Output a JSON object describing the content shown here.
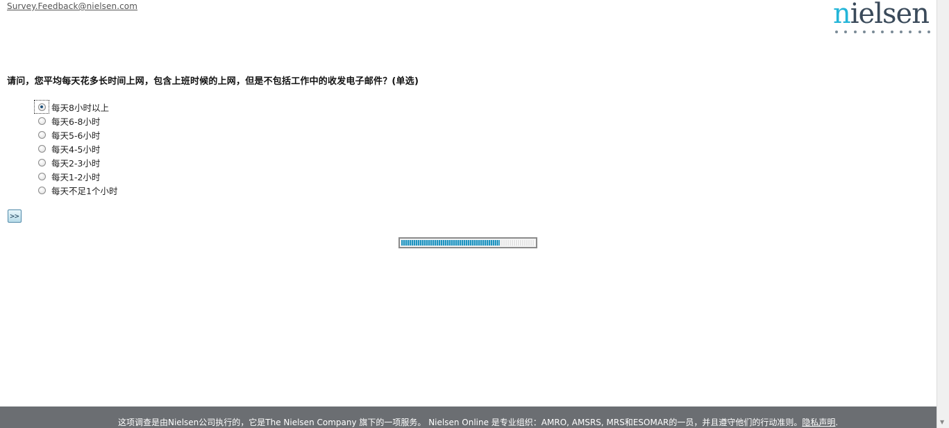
{
  "header": {
    "feedback_email": "Survey.Feedback@nielsen.com",
    "logo_text_first": "n",
    "logo_text_rest": "ielsen"
  },
  "question": {
    "text": "请问，您平均每天花多长时间上网，包含上班时候的上网，但是不包括工作中的收发电子邮件？(单选)",
    "options": [
      {
        "label": "每天8小时以上",
        "selected": true
      },
      {
        "label": "每天6-8小时",
        "selected": false
      },
      {
        "label": "每天5-6小时",
        "selected": false
      },
      {
        "label": "每天4-5小时",
        "selected": false
      },
      {
        "label": "每天2-3小时",
        "selected": false
      },
      {
        "label": "每天1-2小时",
        "selected": false
      },
      {
        "label": "每天不足1个小时",
        "selected": false
      }
    ]
  },
  "navigation": {
    "next_label": ">>"
  },
  "progress": {
    "fraction": 0.74
  },
  "footer": {
    "text": "这项调查是由Nielsen公司执行的，它是The Nielsen Company 旗下的一项服务。  Nielsen Online 是专业组织：AMRO, AMSRS, MRS和ESOMAR的一员，并且遵守他们的行动准则。",
    "privacy_label": "隐私声明",
    "end_punct": "."
  },
  "colors": {
    "accent": "#23b5d8",
    "progress_fill": "#1f93bf",
    "footer_bg": "#6b6e72"
  }
}
